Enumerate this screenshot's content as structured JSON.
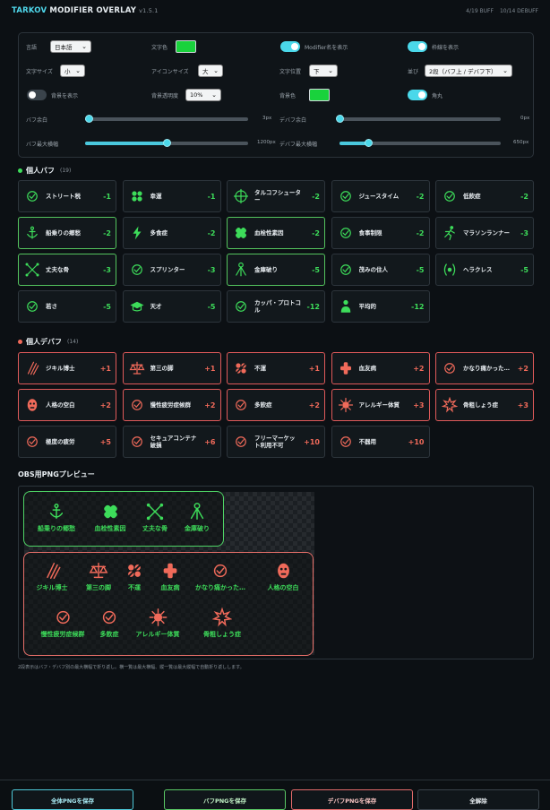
{
  "app": {
    "title_main": "TARKOV",
    "title_rest": " MODIFIER OVERLAY",
    "version": "v1.5.1",
    "buff_count": "4/19 BUFF",
    "debuff_count": "10/14 DEBUFF"
  },
  "settings": {
    "language": {
      "label": "言語",
      "value": "日本語"
    },
    "text_color": {
      "label": "文字色",
      "color": "#19d23c"
    },
    "show_modifier_name": {
      "label": "Modifier名を表示",
      "on": true
    },
    "show_frame": {
      "label": "枠線を表示",
      "on": true
    },
    "text_size": {
      "label": "文字サイズ",
      "value": "小"
    },
    "icon_size": {
      "label": "アイコンサイズ",
      "value": "大"
    },
    "text_position": {
      "label": "文字位置",
      "value": "下"
    },
    "arrangement": {
      "label": "並び",
      "value": "2段（バフ上 / デバフ下）"
    },
    "show_background": {
      "label": "背景を表示",
      "on": false
    },
    "bg_opacity": {
      "label": "背景透明度",
      "value": "10%"
    },
    "bg_color": {
      "label": "背景色",
      "color": "#19d23c"
    },
    "rounded": {
      "label": "角丸",
      "on": true
    },
    "buff_margin": {
      "label": "バフ余白",
      "value": "3px",
      "fraction": 0.02
    },
    "debuff_margin": {
      "label": "デバフ余白",
      "value": "0px",
      "fraction": 0.0
    },
    "buff_max_width": {
      "label": "バフ最大横幅",
      "value": "1200px",
      "fraction": 0.5
    },
    "debuff_max_width": {
      "label": "デバフ最大横幅",
      "value": "650px",
      "fraction": 0.18
    }
  },
  "buffs": {
    "title": "個人バフ",
    "count": "(19)",
    "items": [
      {
        "name": "ストリート税",
        "value": "-1",
        "icon": "street-tax-icon",
        "selected": false
      },
      {
        "name": "幸運",
        "value": "-1",
        "icon": "clover-icon",
        "selected": false
      },
      {
        "name": "タルコフシューター",
        "value": "-2",
        "icon": "crosshair-icon",
        "selected": false
      },
      {
        "name": "ジュースタイム",
        "value": "-2",
        "icon": "juice-icon",
        "selected": false
      },
      {
        "name": "低飲症",
        "value": "-2",
        "icon": "bottle-icon",
        "selected": false
      },
      {
        "name": "船乗りの郷愁",
        "value": "-2",
        "icon": "anchor-icon",
        "selected": true
      },
      {
        "name": "多食症",
        "value": "-2",
        "icon": "lightning-icon",
        "selected": false
      },
      {
        "name": "血栓性素因",
        "value": "-2",
        "icon": "bandage-icon",
        "selected": true
      },
      {
        "name": "食事制限",
        "value": "-2",
        "icon": "food-icon",
        "selected": false
      },
      {
        "name": "マラソンランナー",
        "value": "-3",
        "icon": "runner-icon",
        "selected": false
      },
      {
        "name": "丈夫な骨",
        "value": "-3",
        "icon": "crossbones-icon",
        "selected": true
      },
      {
        "name": "スプリンター",
        "value": "-3",
        "icon": "shoe-icon",
        "selected": false
      },
      {
        "name": "金庫破り",
        "value": "-5",
        "icon": "lockpick-icon",
        "selected": true
      },
      {
        "name": "茂みの住人",
        "value": "-5",
        "icon": "bush-icon",
        "selected": false
      },
      {
        "name": "ヘラクレス",
        "value": "-5",
        "icon": "laurel-icon",
        "selected": false
      },
      {
        "name": "若さ",
        "value": "-5",
        "icon": "youth-icon",
        "selected": false
      },
      {
        "name": "天才",
        "value": "-5",
        "icon": "graduation-icon",
        "selected": false
      },
      {
        "name": "カッパ・プロトコル",
        "value": "-12",
        "icon": "kappa-icon",
        "selected": false
      },
      {
        "name": "平均的",
        "value": "-12",
        "icon": "person-icon",
        "selected": false
      }
    ]
  },
  "debuffs": {
    "title": "個人デバフ",
    "count": "(14)",
    "items": [
      {
        "name": "ジキル博士",
        "value": "+1",
        "icon": "claw-icon",
        "selected": true
      },
      {
        "name": "第三の脚",
        "value": "+1",
        "icon": "scales-icon",
        "selected": true
      },
      {
        "name": "不運",
        "value": "+1",
        "icon": "broken-clover-icon",
        "selected": true
      },
      {
        "name": "血友病",
        "value": "+2",
        "icon": "blood-icon",
        "selected": true
      },
      {
        "name": "かなり痛かった…",
        "value": "+2",
        "icon": "pain-icon",
        "selected": true
      },
      {
        "name": "人格の空白",
        "value": "+2",
        "icon": "mask-icon",
        "selected": true
      },
      {
        "name": "慢性疲労症候群",
        "value": "+2",
        "icon": "fatigue-icon",
        "selected": true
      },
      {
        "name": "多飲症",
        "value": "+2",
        "icon": "drink-icon",
        "selected": true
      },
      {
        "name": "アレルギー体質",
        "value": "+3",
        "icon": "allergy-icon",
        "selected": true
      },
      {
        "name": "骨粗しょう症",
        "value": "+3",
        "icon": "bone-burst-icon",
        "selected": true
      },
      {
        "name": "極度の疲労",
        "value": "+5",
        "icon": "exhausted-icon",
        "selected": false
      },
      {
        "name": "セキュアコンテナ破損",
        "value": "+6",
        "icon": "container-icon",
        "selected": false
      },
      {
        "name": "フリーマーケット利用不可",
        "value": "+10",
        "icon": "no-market-icon",
        "selected": false
      },
      {
        "name": "不器用",
        "value": "+10",
        "icon": "clumsy-icon",
        "selected": false
      }
    ]
  },
  "preview": {
    "title": "OBS用PNGプレビュー",
    "buff_labels": [
      "船乗りの郷愁",
      "血栓性素因",
      "丈夫な骨",
      "金庫破り"
    ],
    "debuff_labels": [
      "ジキル博士",
      "第三の脚",
      "不運",
      "血友病",
      "かなり痛かった…",
      "人格の空白",
      "慢性疲労症候群",
      "多飲症",
      "アレルギー体質",
      "骨粗しょう症"
    ],
    "footnote": "2段表示はバフ・デバフ別の最大横幅で折り返し。横一覧は最大横幅、縦一覧は最大縦幅で自動折り返しします。"
  },
  "buttons": {
    "save_all": "全体PNGを保存",
    "save_buff": "バフPNGを保存",
    "save_debuff": "デバフPNGを保存",
    "clear_all": "全解除"
  },
  "colors": {
    "buff": "#3ddc5a",
    "debuff": "#f06a5a",
    "accent": "#4ad8ea"
  }
}
